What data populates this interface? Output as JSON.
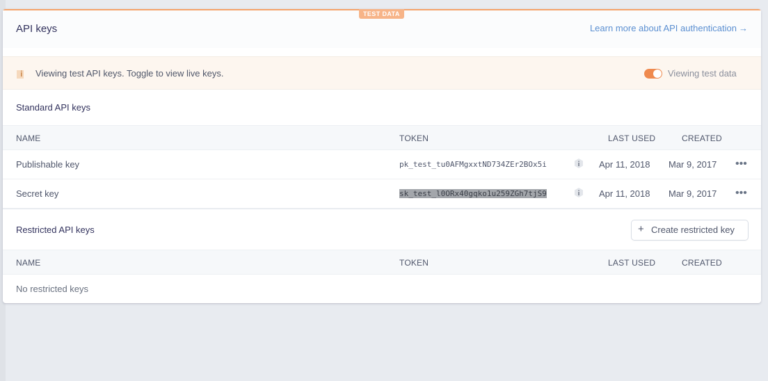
{
  "header": {
    "title": "API keys",
    "badge": "TEST DATA",
    "learn_more_link": "Learn more about API authentication",
    "learn_more_arrow": "→"
  },
  "notice": {
    "icon": "info-icon",
    "text": "Viewing test API keys. Toggle to view live keys.",
    "toggle_label": "Viewing test data",
    "toggle_on": true
  },
  "standard": {
    "title": "Standard API keys",
    "columns": {
      "name": "NAME",
      "token": "TOKEN",
      "last_used": "LAST USED",
      "created": "CREATED"
    },
    "rows": [
      {
        "name": "Publishable key",
        "token": "pk_test_tu0AFMgxxtND734ZEr2BOx5i",
        "last_used": "Apr 11, 2018",
        "created": "Mar 9, 2017",
        "selected": false
      },
      {
        "name": "Secret key",
        "token": "sk_test_l0ORx40gqko1u259ZGh7tjS9",
        "last_used": "Apr 11, 2018",
        "created": "Mar 9, 2017",
        "selected": true
      }
    ],
    "more_icon": "•••"
  },
  "restricted": {
    "title": "Restricted API keys",
    "create_button": "Create restricted key",
    "create_icon": "+",
    "columns": {
      "name": "NAME",
      "token": "TOKEN",
      "last_used": "LAST USED",
      "created": "CREATED"
    },
    "empty_text": "No restricted keys"
  },
  "colors": {
    "accent": "#ef8a4f",
    "link": "#5b8fd1",
    "badge": "#f7b488"
  }
}
